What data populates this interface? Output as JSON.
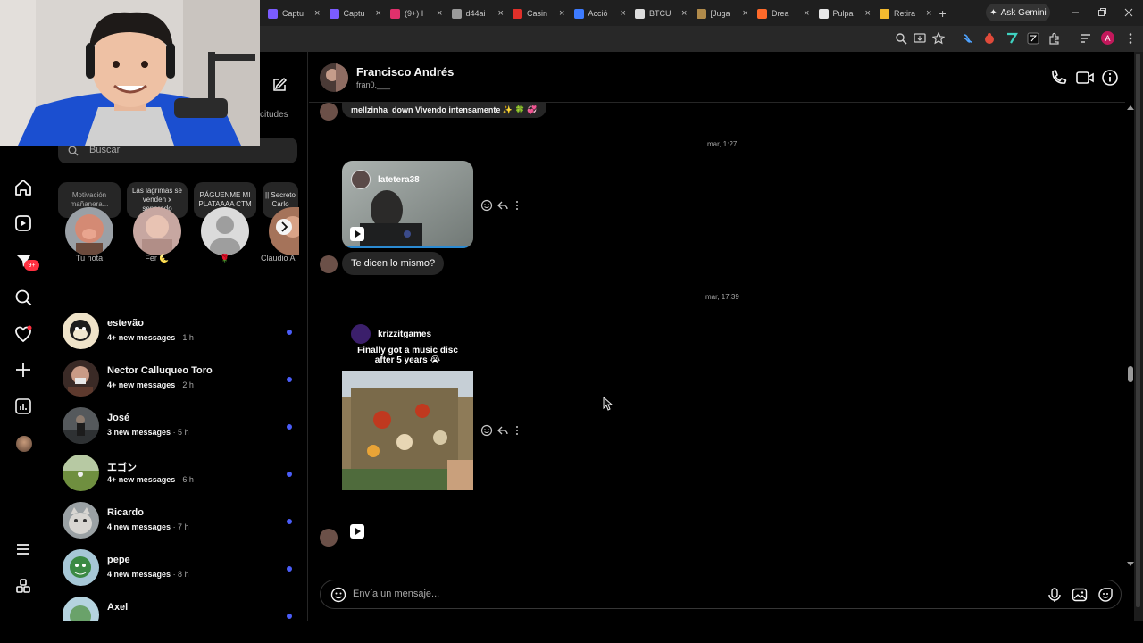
{
  "browser": {
    "tabs": [
      {
        "label": "Captu",
        "color": "#7b5cff"
      },
      {
        "label": "Captu",
        "color": "#7b5cff"
      },
      {
        "label": "(9+) I",
        "color": "#e1306c"
      },
      {
        "label": "d44ai",
        "color": "#9a9a9a"
      },
      {
        "label": "Casin",
        "color": "#e0302a"
      },
      {
        "label": "Acció",
        "color": "#3d7bff"
      },
      {
        "label": "BTCU",
        "color": "#dddddd"
      },
      {
        "label": "[Juga",
        "color": "#b08a4a"
      },
      {
        "label": "Drea",
        "color": "#ff6a2a"
      },
      {
        "label": "Pulpa",
        "color": "#e8e8e8"
      },
      {
        "label": "Retira",
        "color": "#f3ba2f"
      }
    ],
    "ask_gemini": "Ask Gemini",
    "new_tab": "+",
    "profile_initial": "A"
  },
  "sidebar": {
    "search_placeholder": "Buscar",
    "requests_label": "citudes",
    "unread_badge": "9+"
  },
  "notes": [
    {
      "text": "Motivación mañanera...",
      "name": "Tu nota"
    },
    {
      "text": "Las lágrimas se venden x separado",
      "name": "Fer 🌜"
    },
    {
      "text": "PÁGUENME MI PLATAAAA CTM",
      "name": "🌹"
    },
    {
      "text": "|| Secreto Carlo",
      "name": "Claudio Al"
    }
  ],
  "conversations": [
    {
      "name": "estevão",
      "status": "4+ new messages",
      "time": "· 1 h"
    },
    {
      "name": "Nector Calluqueo Toro",
      "status": "4+ new messages",
      "time": "· 2 h"
    },
    {
      "name": "José",
      "status": "3 new messages",
      "time": "· 5 h"
    },
    {
      "name": "エゴン",
      "status": "4+ new messages",
      "time": "· 6 h"
    },
    {
      "name": "Ricardo",
      "status": "4 new messages",
      "time": "· 7 h"
    },
    {
      "name": "pepe",
      "status": "4 new messages",
      "time": "· 8 h"
    },
    {
      "name": "Axel",
      "status": "",
      "time": ""
    }
  ],
  "chat": {
    "contact_name": "Francisco Andrés",
    "contact_handle": "fran0.___",
    "messages": {
      "prev_text": "mellzinha_down Vivendo intensamente ✨ 🍀 💞",
      "ts1": "mar, 1:27",
      "reel1_user": "latetera38",
      "reply_text": "Te dicen lo mismo?",
      "ts2": "mar, 17:39",
      "reel2_user": "krizzitgames",
      "reel2_caption": "Finally got a music disc after 5 years 😭"
    },
    "composer_placeholder": "Envía un mensaje..."
  },
  "colors": {
    "unread_dot": "#4a5df9",
    "badge": "#ff3040",
    "bubble": "#262626"
  }
}
